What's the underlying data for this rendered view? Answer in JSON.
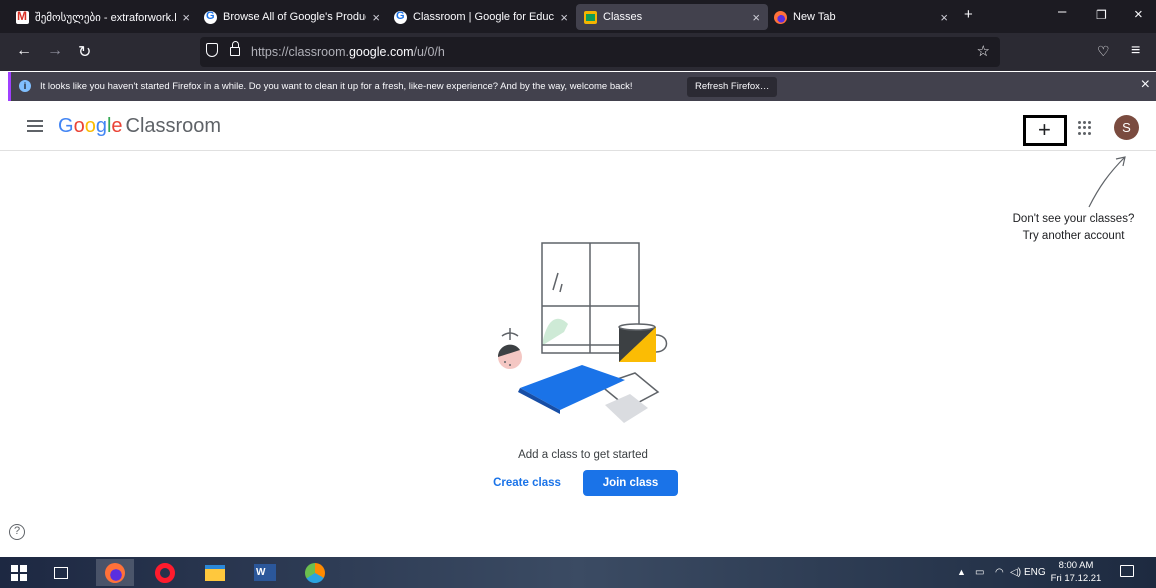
{
  "browser": {
    "tabs": [
      {
        "label": "შემოსულები - extraforwork.l",
        "favicon": "gmail-icon",
        "active": false
      },
      {
        "label": "Browse All of Google's Products",
        "favicon": "google-icon",
        "active": false
      },
      {
        "label": "Classroom | Google for Educatic",
        "favicon": "google-icon",
        "active": false
      },
      {
        "label": "Classes",
        "favicon": "classroom-icon",
        "active": true
      },
      {
        "label": "New Tab",
        "favicon": "firefox-icon",
        "active": false
      }
    ],
    "url_prefix": "https://classroom.",
    "url_domain": "google.com",
    "url_path": "/u/0/h",
    "notification": {
      "message": "It looks like you haven't started Firefox in a while. Do you want to clean it up for a fresh, like-new experience? And by the way, welcome back!",
      "button": "Refresh Firefox…"
    }
  },
  "header": {
    "logo_g": "G",
    "logo_o1": "o",
    "logo_o2": "o",
    "logo_g2": "g",
    "logo_l": "l",
    "logo_e": "e",
    "logo_classroom": "Classroom",
    "plus": "+",
    "avatar_letter": "S"
  },
  "hint": {
    "line1": "Don't see your classes?",
    "line2": "Try another account"
  },
  "empty_state": {
    "title": "Add a class to get started",
    "create_label": "Create class",
    "join_label": "Join class"
  },
  "help_icon": "?",
  "taskbar": {
    "language": "ENG",
    "time": "8:00 AM",
    "date": "Fri 17.12.21"
  },
  "colors": {
    "brand_blue": "#1a73e8",
    "firefox_dark": "#1c1b22"
  }
}
